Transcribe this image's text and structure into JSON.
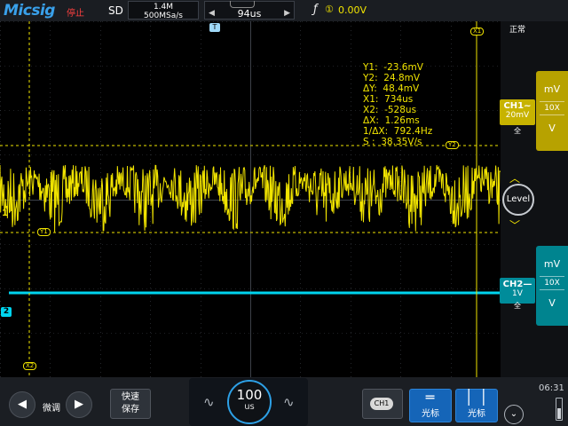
{
  "header": {
    "logo": "Micsig",
    "run_state": "停止",
    "acq_mode": "SD",
    "memory_depth": "1.4M",
    "sample_rate": "500MSa/s",
    "time_offset": "94us",
    "trigger_source": "①",
    "trigger_level": "0.00V",
    "time_left_arrow": "◀",
    "time_right_arrow": "▶",
    "trigger_slope_glyph": "ƒ"
  },
  "scope": {
    "trigger_position_marker": "T",
    "ch1_ground_marker": "1",
    "ch2_ground_marker": "2",
    "cursor_tags": {
      "y1": "Y1",
      "y2": "Y2",
      "x1": "X1",
      "x2": "X2"
    },
    "cursor_readout": {
      "y1": "Y1:  -23.6mV",
      "y2": "Y2:  24.8mV",
      "dy": "ΔY:  48.4mV",
      "x1": "X1:  734us",
      "x2": "X2:  -528us",
      "dx": "ΔX:  1.26ms",
      "inv_dx": "1/ΔX:  792.4Hz",
      "slope": "S :  38.35V/s"
    },
    "colors": {
      "ch1": "#f1e400",
      "ch2": "#00d4ee",
      "grid": "#3c4048"
    }
  },
  "right_panel": {
    "corner_label": "正常",
    "level_label": "Level",
    "ch1": {
      "name": "CH1~",
      "scale": "20mV",
      "coupling": "全",
      "unit_top": "mV",
      "probe": "10X",
      "unit_bottom": "V"
    },
    "ch2": {
      "name": "CH2—",
      "scale": "1V",
      "coupling": "全",
      "unit_top": "mV",
      "probe": "10X",
      "unit_bottom": "V"
    },
    "chevron_up": "︿",
    "chevron_down": "﹀"
  },
  "bottom_bar": {
    "prev_icon": "◀",
    "next_icon": "▶",
    "fine_label": "微调",
    "quick_save_line1": "快速",
    "quick_save_line2": "保存",
    "timebase_value": "100",
    "timebase_unit": "us",
    "wave_glyph": "∿",
    "ch1_select_label": "CH1",
    "h_cursor_label": "光标",
    "v_cursor_label": "光标",
    "clock": "06:31",
    "collapse_icon": "⌄"
  }
}
